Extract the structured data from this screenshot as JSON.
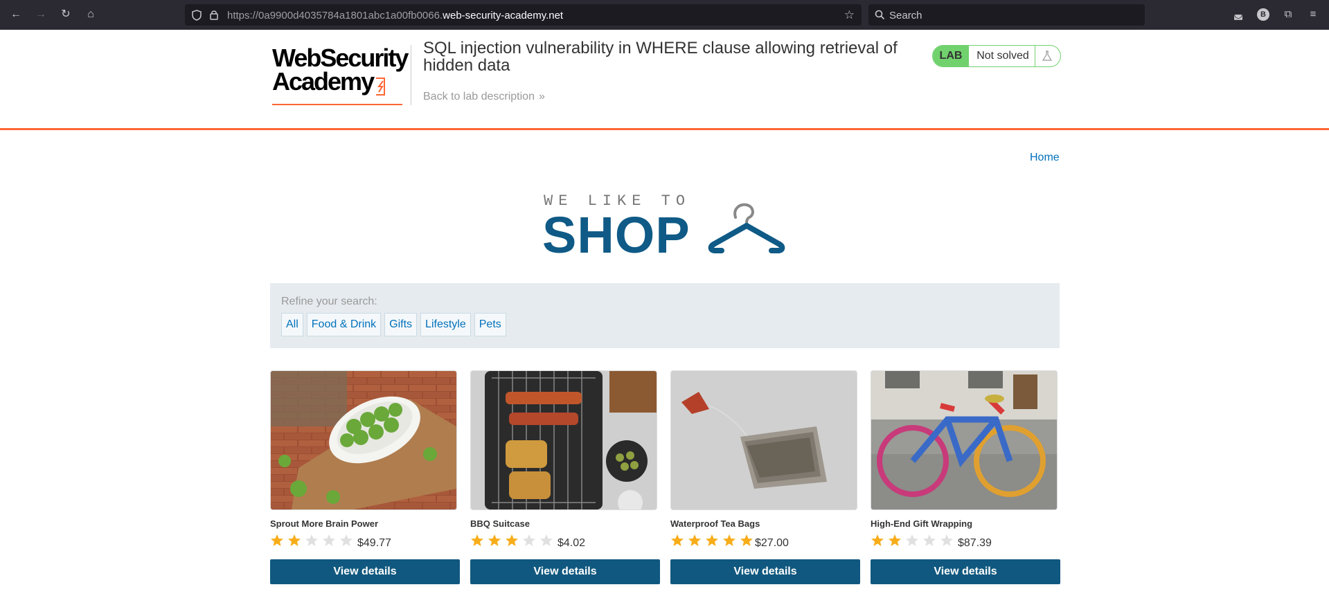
{
  "browser": {
    "url_prefix": "https://0a9900d4035784a1801abc1a00fb0066.",
    "url_host": "web-security-academy.net",
    "search_placeholder": "Search",
    "profile_initial": "B"
  },
  "lab_header": {
    "logo_line1": "WebSecurity",
    "logo_line2": "Academy",
    "title": "SQL injection vulnerability in WHERE clause allowing retrieval of hidden data",
    "back_link": "Back to lab description",
    "back_arrow": "»",
    "status_tag": "LAB",
    "status_text": "Not solved",
    "accent_color": "#ff6633",
    "status_color": "#70d16d"
  },
  "nav": {
    "home": "Home"
  },
  "brand": {
    "small": "WE LIKE TO",
    "big": "SHOP"
  },
  "filter": {
    "label": "Refine your search:",
    "categories": [
      "All",
      "Food & Drink",
      "Gifts",
      "Lifestyle",
      "Pets"
    ]
  },
  "products": [
    {
      "name": "Sprout More Brain Power",
      "rating": 2,
      "price": "$49.77",
      "button": "View details",
      "image": "brussels-sprouts-photo"
    },
    {
      "name": "BBQ Suitcase",
      "rating": 3,
      "price": "$4.02",
      "button": "View details",
      "image": "bbq-grill-photo"
    },
    {
      "name": "Waterproof Tea Bags",
      "rating": 5,
      "price": "$27.00",
      "button": "View details",
      "image": "tea-bag-photo"
    },
    {
      "name": "High-End Gift Wrapping",
      "rating": 2,
      "price": "$87.39",
      "button": "View details",
      "image": "knitted-bike-photo"
    }
  ],
  "colors": {
    "button": "#10587f",
    "link": "#0071bc",
    "star_on": "#f7ad1a",
    "star_off": "#e0e0e0"
  }
}
